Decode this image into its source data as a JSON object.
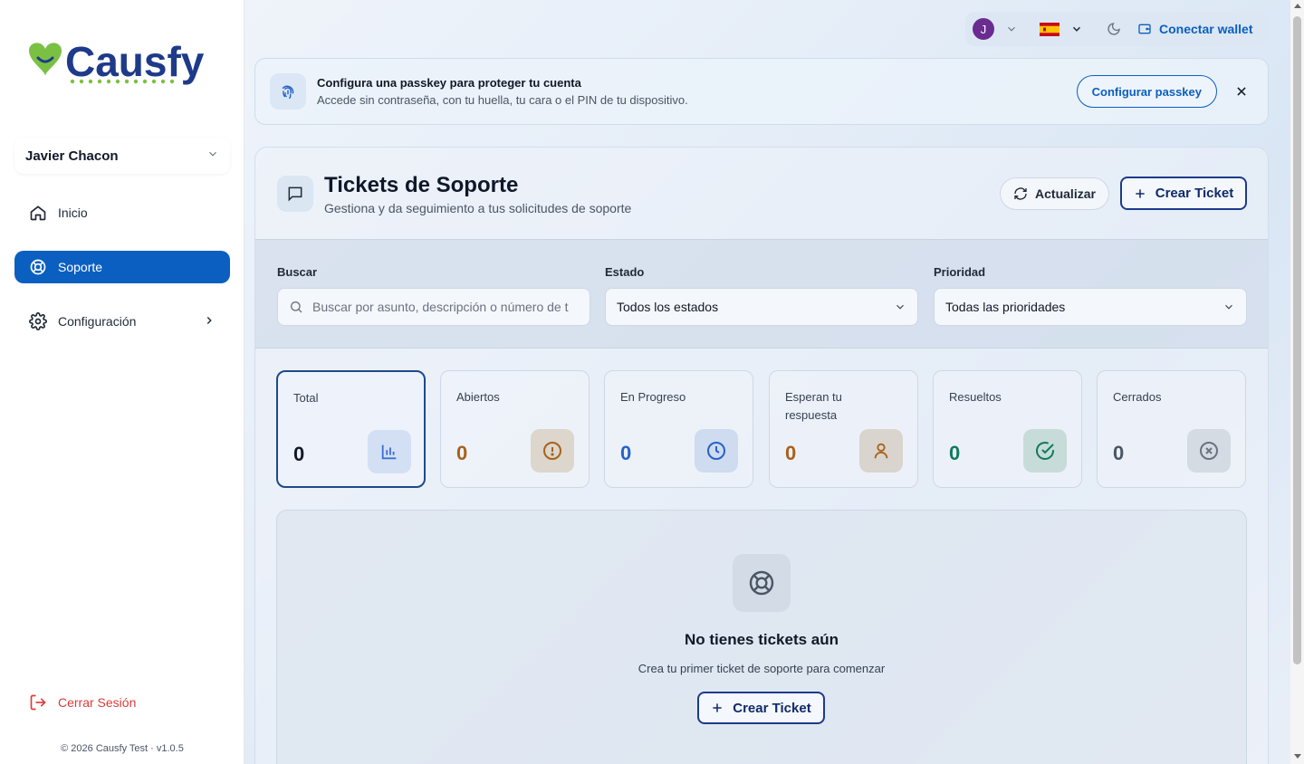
{
  "brand": {
    "name": "Causfy",
    "color_primary": "#1e3a8a",
    "color_heart": "#7ac143"
  },
  "sidebar": {
    "user_name": "Javier Chacon",
    "items": [
      {
        "label": "Inicio",
        "icon": "home-icon",
        "active": false
      },
      {
        "label": "Soporte",
        "icon": "lifebuoy-icon",
        "active": true
      },
      {
        "label": "Configuración",
        "icon": "gear-icon",
        "active": false
      }
    ],
    "logout_label": "Cerrar Sesión",
    "footer": "© 2026 Causfy Test · v1.0.5"
  },
  "topbar": {
    "avatar_initial": "J",
    "language_flag": "es-flag-icon",
    "wallet_label": "Conectar wallet"
  },
  "banner": {
    "title": "Configura una passkey para proteger tu cuenta",
    "subtitle": "Accede sin contraseña, con tu huella, tu cara o el PIN de tu dispositivo.",
    "button_label": "Configurar passkey"
  },
  "header": {
    "title": "Tickets de Soporte",
    "subtitle": "Gestiona y da seguimiento a tus solicitudes de soporte",
    "refresh_label": "Actualizar",
    "create_label": "Crear Ticket"
  },
  "filters": {
    "search_label": "Buscar",
    "search_placeholder": "Buscar por asunto, descripción o número de t",
    "status_label": "Estado",
    "status_value": "Todos los estados",
    "priority_label": "Prioridad",
    "priority_value": "Todas las prioridades"
  },
  "stats": [
    {
      "label": "Total",
      "value": "0",
      "icon": "bar-chart-icon",
      "color": "#111827",
      "icon_color": "#3b6fd4",
      "icon_bg": "#d3e0f4"
    },
    {
      "label": "Abiertos",
      "value": "0",
      "icon": "alert-circle-icon",
      "color": "#a8611a",
      "icon_color": "#a8611a",
      "icon_bg": "#dcd6cc"
    },
    {
      "label": "En Progreso",
      "value": "0",
      "icon": "clock-icon",
      "color": "#2563c9",
      "icon_color": "#2563c9",
      "icon_bg": "#cfdbef"
    },
    {
      "label": "Esperan tu respuesta",
      "value": "0",
      "icon": "user-icon",
      "color": "#a8611a",
      "icon_color": "#a8611a",
      "icon_bg": "#d9d4ce"
    },
    {
      "label": "Resueltos",
      "value": "0",
      "icon": "check-circle-icon",
      "color": "#0f7a5a",
      "icon_color": "#0f7a5a",
      "icon_bg": "#c7dcd8"
    },
    {
      "label": "Cerrados",
      "value": "0",
      "icon": "x-circle-icon",
      "color": "#4b5563",
      "icon_color": "#6b7280",
      "icon_bg": "#d5dbe3"
    }
  ],
  "empty": {
    "title": "No tienes tickets aún",
    "subtitle": "Crea tu primer ticket de soporte para comenzar",
    "button_label": "Crear Ticket"
  }
}
